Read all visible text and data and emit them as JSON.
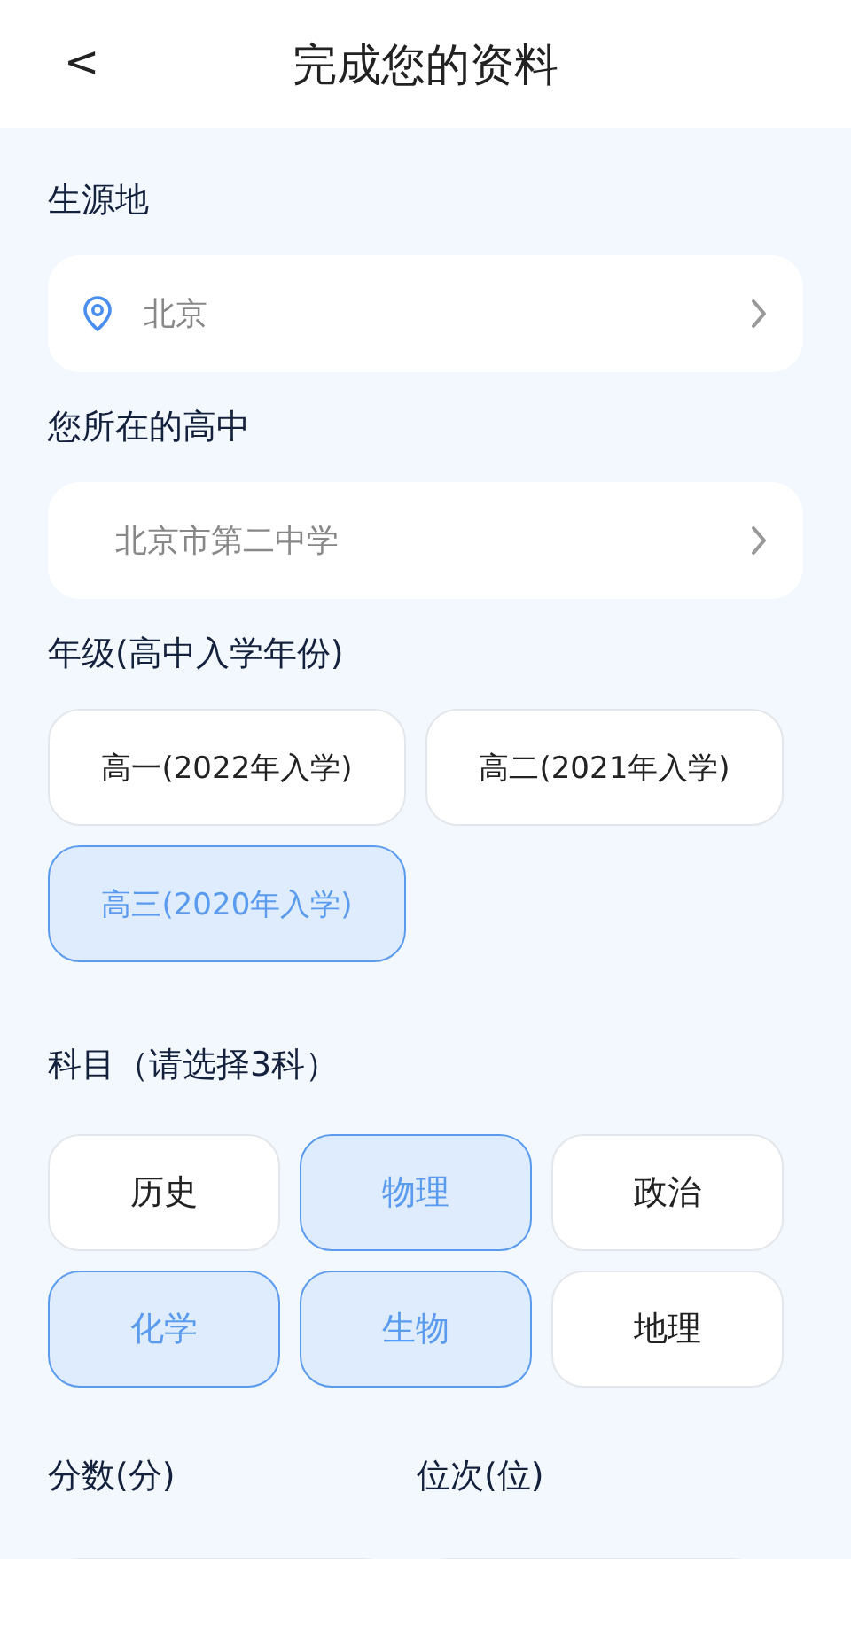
{
  "header": {
    "back": "<",
    "title": "完成您的资料"
  },
  "origin": {
    "label": "生源地",
    "value": "北京"
  },
  "school": {
    "label": "您所在的高中",
    "value": "北京市第二中学"
  },
  "grade": {
    "label": "年级(高中入学年份)",
    "options": [
      {
        "label": "高一(2022年入学)",
        "selected": false
      },
      {
        "label": "高二(2021年入学)",
        "selected": false
      },
      {
        "label": "高三(2020年入学)",
        "selected": true
      }
    ]
  },
  "subjects": {
    "label": "科目（请选择3科）",
    "options": [
      {
        "label": "历史",
        "selected": false
      },
      {
        "label": "物理",
        "selected": true
      },
      {
        "label": "政治",
        "selected": false
      },
      {
        "label": "化学",
        "selected": true
      },
      {
        "label": "生物",
        "selected": true
      },
      {
        "label": "地理",
        "selected": false
      }
    ]
  },
  "score": {
    "label": "分数(分)"
  },
  "rank": {
    "label": "位次(位)"
  }
}
